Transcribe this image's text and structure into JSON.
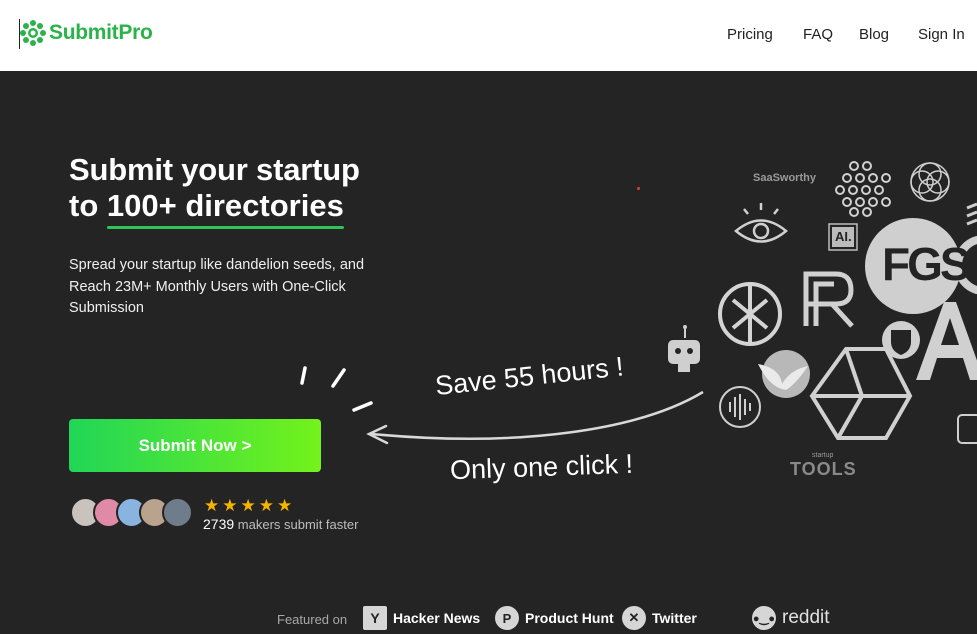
{
  "header": {
    "brand": "SubmitPro",
    "nav": [
      "Pricing",
      "FAQ",
      "Blog",
      "Sign In"
    ]
  },
  "hero": {
    "title_line1": "Submit your startup",
    "title_line2_prefix": "to ",
    "title_line2_highlight": "100+ directories",
    "subtitle": "Spread your startup like dandelion seeds, and Reach 23M+ Monthly Users with One-Click Submission",
    "cta_label": "Submit Now >",
    "stars": "★★★★★",
    "makers_count": "2739",
    "makers_text": "makers submit faster",
    "rating": 5
  },
  "annotations": {
    "save": "Save 55 hours !",
    "click": "Only one click !"
  },
  "directory_logos": {
    "saasworthy": "SaaSworthy",
    "ai": "AI.",
    "fgs": "FGS",
    "startup_tools_small": "startup",
    "startup_tools": "TOOLS"
  },
  "featured": {
    "label": "Featured on",
    "items": [
      "Hacker News",
      "Product Hunt",
      "Twitter",
      "reddit"
    ]
  },
  "colors": {
    "brand_green": "#2bb34a",
    "background": "#242424",
    "cta_start": "#20d657",
    "cta_end": "#74f21b",
    "star": "#f5b400"
  }
}
